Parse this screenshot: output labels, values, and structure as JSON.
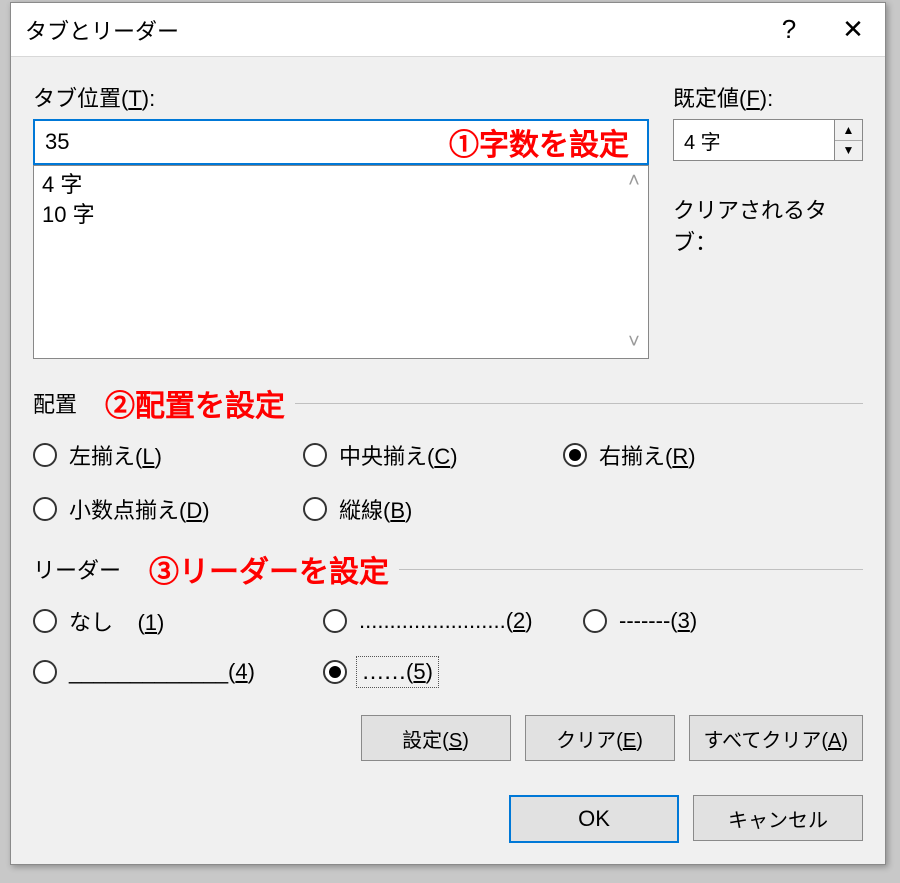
{
  "title": "タブとリーダー",
  "help_glyph": "?",
  "close_glyph": "✕",
  "tab_pos_label_pre": "タブ位置(",
  "tab_pos_label_key": "T",
  "tab_pos_label_post": "):",
  "tab_pos_value": "35",
  "annot1": "①字数を設定",
  "tab_list": {
    "i0": "4 字",
    "i1": "10 字"
  },
  "default_label_pre": "既定値(",
  "default_label_key": "F",
  "default_label_post": "):",
  "default_value": "4 字",
  "cleared_label": "クリアされるタブ：",
  "align_label": "配置",
  "annot2": "②配置を設定",
  "align": {
    "left_pre": "左揃え(",
    "left_key": "L",
    "left_post": ")",
    "center_pre": "中央揃え(",
    "center_key": "C",
    "center_post": ")",
    "right_pre": "右揃え(",
    "right_key": "R",
    "right_post": ")",
    "dec_pre": "小数点揃え(",
    "dec_key": "D",
    "dec_post": ")",
    "bar_pre": "縦線(",
    "bar_key": "B",
    "bar_post": ")"
  },
  "leader_label": "リーダー",
  "annot3": "③リーダーを設定",
  "leader": {
    "none_label": "なし",
    "k1": "1",
    "opt2_text": "........................(",
    "k2": "2",
    "opt3_text": "-------(",
    "k3": "3",
    "opt4_text": "_____________(",
    "k4": "4",
    "opt5_text": "‥‥‥(",
    "k5": "5",
    "close": ")"
  },
  "btn_set_pre": "設定(",
  "btn_set_key": "S",
  "btn_set_post": ")",
  "btn_clear_pre": "クリア(",
  "btn_clear_key": "E",
  "btn_clear_post": ")",
  "btn_clearall_pre": "すべてクリア(",
  "btn_clearall_key": "A",
  "btn_clearall_post": ")",
  "btn_ok": "OK",
  "btn_cancel": "キャンセル"
}
